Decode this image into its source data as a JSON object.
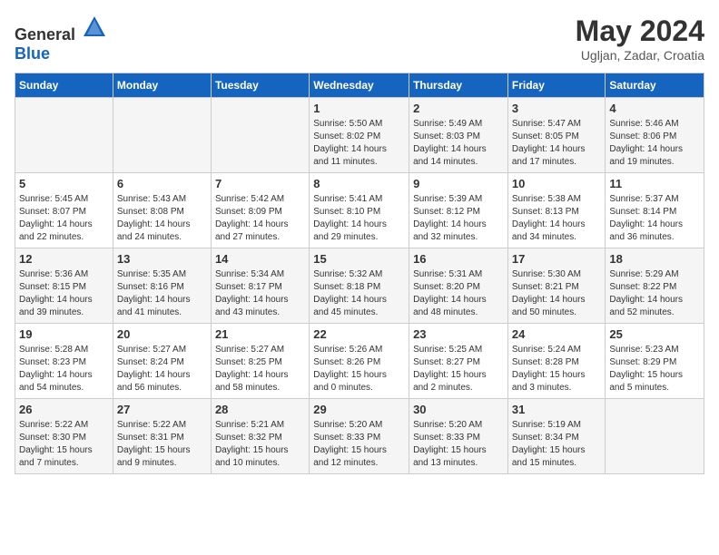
{
  "header": {
    "logo_general": "General",
    "logo_blue": "Blue",
    "month_year": "May 2024",
    "location": "Ugljan, Zadar, Croatia"
  },
  "days_of_week": [
    "Sunday",
    "Monday",
    "Tuesday",
    "Wednesday",
    "Thursday",
    "Friday",
    "Saturday"
  ],
  "weeks": [
    [
      {
        "day": "",
        "info": ""
      },
      {
        "day": "",
        "info": ""
      },
      {
        "day": "",
        "info": ""
      },
      {
        "day": "1",
        "info": "Sunrise: 5:50 AM\nSunset: 8:02 PM\nDaylight: 14 hours\nand 11 minutes."
      },
      {
        "day": "2",
        "info": "Sunrise: 5:49 AM\nSunset: 8:03 PM\nDaylight: 14 hours\nand 14 minutes."
      },
      {
        "day": "3",
        "info": "Sunrise: 5:47 AM\nSunset: 8:05 PM\nDaylight: 14 hours\nand 17 minutes."
      },
      {
        "day": "4",
        "info": "Sunrise: 5:46 AM\nSunset: 8:06 PM\nDaylight: 14 hours\nand 19 minutes."
      }
    ],
    [
      {
        "day": "5",
        "info": "Sunrise: 5:45 AM\nSunset: 8:07 PM\nDaylight: 14 hours\nand 22 minutes."
      },
      {
        "day": "6",
        "info": "Sunrise: 5:43 AM\nSunset: 8:08 PM\nDaylight: 14 hours\nand 24 minutes."
      },
      {
        "day": "7",
        "info": "Sunrise: 5:42 AM\nSunset: 8:09 PM\nDaylight: 14 hours\nand 27 minutes."
      },
      {
        "day": "8",
        "info": "Sunrise: 5:41 AM\nSunset: 8:10 PM\nDaylight: 14 hours\nand 29 minutes."
      },
      {
        "day": "9",
        "info": "Sunrise: 5:39 AM\nSunset: 8:12 PM\nDaylight: 14 hours\nand 32 minutes."
      },
      {
        "day": "10",
        "info": "Sunrise: 5:38 AM\nSunset: 8:13 PM\nDaylight: 14 hours\nand 34 minutes."
      },
      {
        "day": "11",
        "info": "Sunrise: 5:37 AM\nSunset: 8:14 PM\nDaylight: 14 hours\nand 36 minutes."
      }
    ],
    [
      {
        "day": "12",
        "info": "Sunrise: 5:36 AM\nSunset: 8:15 PM\nDaylight: 14 hours\nand 39 minutes."
      },
      {
        "day": "13",
        "info": "Sunrise: 5:35 AM\nSunset: 8:16 PM\nDaylight: 14 hours\nand 41 minutes."
      },
      {
        "day": "14",
        "info": "Sunrise: 5:34 AM\nSunset: 8:17 PM\nDaylight: 14 hours\nand 43 minutes."
      },
      {
        "day": "15",
        "info": "Sunrise: 5:32 AM\nSunset: 8:18 PM\nDaylight: 14 hours\nand 45 minutes."
      },
      {
        "day": "16",
        "info": "Sunrise: 5:31 AM\nSunset: 8:20 PM\nDaylight: 14 hours\nand 48 minutes."
      },
      {
        "day": "17",
        "info": "Sunrise: 5:30 AM\nSunset: 8:21 PM\nDaylight: 14 hours\nand 50 minutes."
      },
      {
        "day": "18",
        "info": "Sunrise: 5:29 AM\nSunset: 8:22 PM\nDaylight: 14 hours\nand 52 minutes."
      }
    ],
    [
      {
        "day": "19",
        "info": "Sunrise: 5:28 AM\nSunset: 8:23 PM\nDaylight: 14 hours\nand 54 minutes."
      },
      {
        "day": "20",
        "info": "Sunrise: 5:27 AM\nSunset: 8:24 PM\nDaylight: 14 hours\nand 56 minutes."
      },
      {
        "day": "21",
        "info": "Sunrise: 5:27 AM\nSunset: 8:25 PM\nDaylight: 14 hours\nand 58 minutes."
      },
      {
        "day": "22",
        "info": "Sunrise: 5:26 AM\nSunset: 8:26 PM\nDaylight: 15 hours\nand 0 minutes."
      },
      {
        "day": "23",
        "info": "Sunrise: 5:25 AM\nSunset: 8:27 PM\nDaylight: 15 hours\nand 2 minutes."
      },
      {
        "day": "24",
        "info": "Sunrise: 5:24 AM\nSunset: 8:28 PM\nDaylight: 15 hours\nand 3 minutes."
      },
      {
        "day": "25",
        "info": "Sunrise: 5:23 AM\nSunset: 8:29 PM\nDaylight: 15 hours\nand 5 minutes."
      }
    ],
    [
      {
        "day": "26",
        "info": "Sunrise: 5:22 AM\nSunset: 8:30 PM\nDaylight: 15 hours\nand 7 minutes."
      },
      {
        "day": "27",
        "info": "Sunrise: 5:22 AM\nSunset: 8:31 PM\nDaylight: 15 hours\nand 9 minutes."
      },
      {
        "day": "28",
        "info": "Sunrise: 5:21 AM\nSunset: 8:32 PM\nDaylight: 15 hours\nand 10 minutes."
      },
      {
        "day": "29",
        "info": "Sunrise: 5:20 AM\nSunset: 8:33 PM\nDaylight: 15 hours\nand 12 minutes."
      },
      {
        "day": "30",
        "info": "Sunrise: 5:20 AM\nSunset: 8:33 PM\nDaylight: 15 hours\nand 13 minutes."
      },
      {
        "day": "31",
        "info": "Sunrise: 5:19 AM\nSunset: 8:34 PM\nDaylight: 15 hours\nand 15 minutes."
      },
      {
        "day": "",
        "info": ""
      }
    ]
  ]
}
